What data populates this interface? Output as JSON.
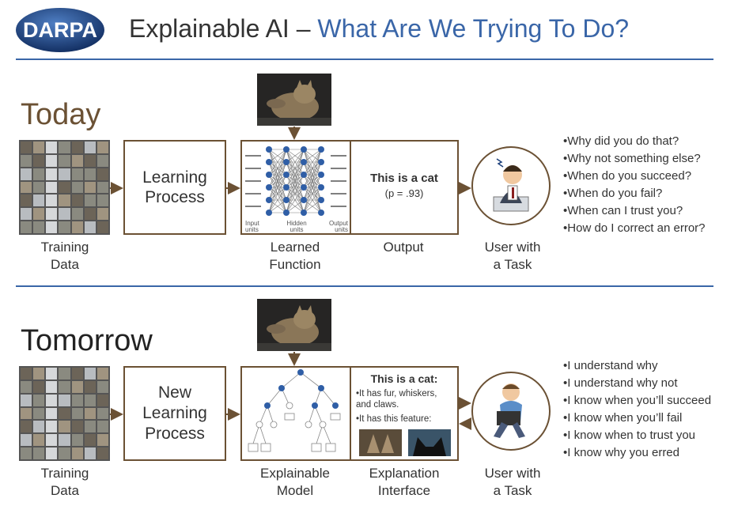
{
  "header": {
    "logo_text": "DARPA",
    "title_black": "Explainable AI – ",
    "title_blue": "What Are We Trying To Do?"
  },
  "today": {
    "heading": "Today",
    "training_caption_1": "Training",
    "training_caption_2": "Data",
    "learning_box_line1": "Learning",
    "learning_box_line2": "Process",
    "function_caption_1": "Learned",
    "function_caption_2": "Function",
    "nn_labels": [
      "Input units",
      "Hidden units",
      "Output units"
    ],
    "output_title": "This is a cat",
    "output_prob": "(p = .93)",
    "output_caption": "Output",
    "user_caption_1": "User with",
    "user_caption_2": "a Task",
    "questions": [
      "Why did you do that?",
      "Why not something else?",
      "When do you succeed?",
      "When do you fail?",
      "When can I trust you?",
      "How do I correct an error?"
    ]
  },
  "tomorrow": {
    "heading": "Tomorrow",
    "training_caption_1": "Training",
    "training_caption_2": "Data",
    "learning_box_line1": "New",
    "learning_box_line2": "Learning",
    "learning_box_line3": "Process",
    "model_caption_1": "Explainable",
    "model_caption_2": "Model",
    "explanation_title": "This is a cat:",
    "explanation_bullet_1": "It has fur, whiskers, and claws.",
    "explanation_bullet_2": "It has this feature:",
    "interface_caption_1": "Explanation",
    "interface_caption_2": "Interface",
    "user_caption_1": "User with",
    "user_caption_2": "a Task",
    "answers": [
      "I understand why",
      "I understand why not",
      "I know when you’ll succeed",
      "I know when you’ll fail",
      "I know when to trust you",
      "I know why you erred"
    ]
  },
  "colors": {
    "accent_blue": "#3a66a8",
    "box_brown": "#6b5134",
    "heading_brown": "#6b5134",
    "logo_blue": "#1c3f7a"
  }
}
